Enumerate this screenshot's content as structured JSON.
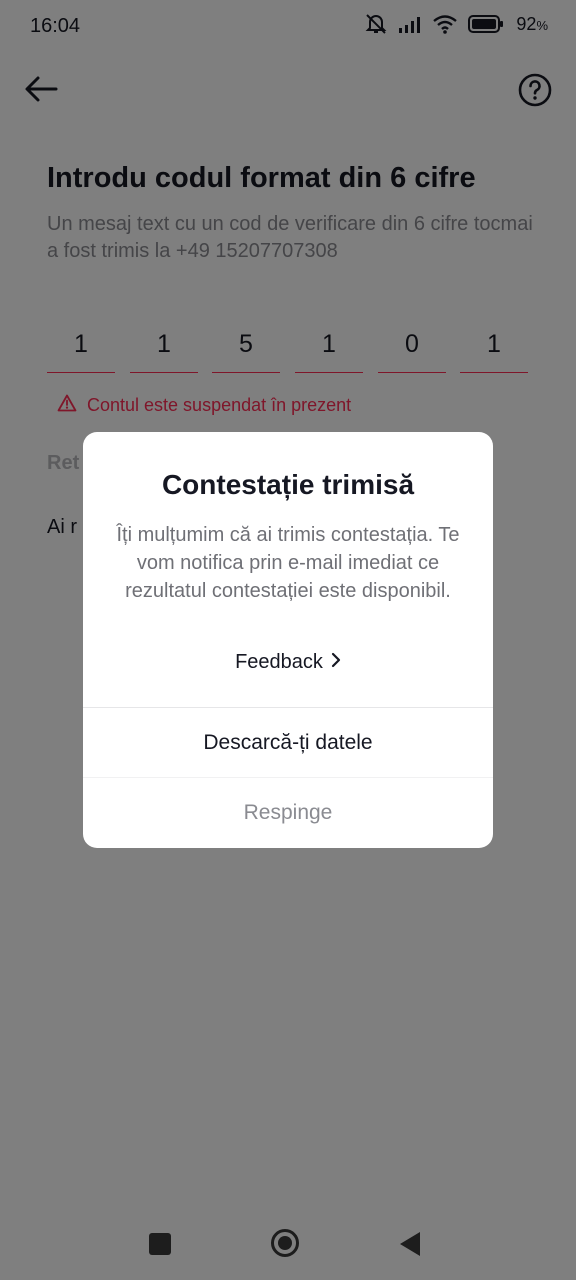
{
  "status_bar": {
    "time": "16:04",
    "battery": "92",
    "battery_unit": "%",
    "icons": [
      "mute-icon",
      "signal-icon",
      "wifi-icon",
      "battery-icon"
    ]
  },
  "header": {
    "back_icon": "arrow-left-icon",
    "help_icon": "question-circle-icon"
  },
  "main": {
    "title": "Introdu codul format din 6 cifre",
    "subtitle": "Un mesaj text cu un cod de verificare din 6 cifre tocmai a fost trimis la +49 15207707308",
    "code_digits": [
      "1",
      "1",
      "5",
      "1",
      "0",
      "1"
    ],
    "error_message": "Contul este suspendat în prezent",
    "resend_partial": "Ret",
    "help_partial": "Ai r"
  },
  "dialog": {
    "title": "Contestație trimisă",
    "message": "Îți mulțumim că ai trimis contestația. Te vom notifica prin e-mail imediat ce rezultatul contestației este disponibil.",
    "feedback_label": "Feedback",
    "download_label": "Descarcă-ți datele",
    "dismiss_label": "Respinge"
  },
  "colors": {
    "accent": "#fe2c55",
    "text_primary": "#161823",
    "text_secondary": "#8a8b91",
    "overlay": "rgba(0,0,0,0.5)"
  }
}
